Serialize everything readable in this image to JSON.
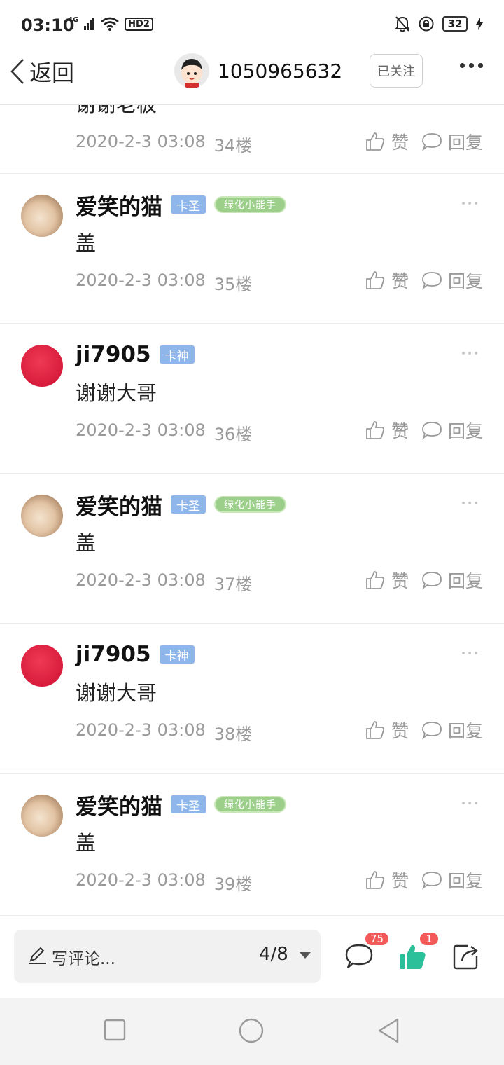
{
  "status": {
    "time": "03:10",
    "network": "4G",
    "hd": "HD2",
    "battery": "32"
  },
  "header": {
    "back_label": "返回",
    "title": "1050965632",
    "follow_label": "已关注"
  },
  "partial_top": {
    "text": "谢谢老板",
    "date": "2020-2-3 03:08",
    "floor": "34楼",
    "like_label": "赞",
    "reply_label": "回复"
  },
  "comments": [
    {
      "name": "爱笑的猫",
      "badge": "卡圣",
      "medal": "绿化小能手",
      "text": "盖",
      "date": "2020-2-3 03:08",
      "floor": "35楼",
      "like_label": "赞",
      "reply_label": "回复"
    },
    {
      "name": "ji7905",
      "badge": "卡神",
      "text": "谢谢大哥",
      "date": "2020-2-3 03:08",
      "floor": "36楼",
      "like_label": "赞",
      "reply_label": "回复"
    },
    {
      "name": "爱笑的猫",
      "badge": "卡圣",
      "medal": "绿化小能手",
      "text": "盖",
      "date": "2020-2-3 03:08",
      "floor": "37楼",
      "like_label": "赞",
      "reply_label": "回复"
    },
    {
      "name": "ji7905",
      "badge": "卡神",
      "text": "谢谢大哥",
      "date": "2020-2-3 03:08",
      "floor": "38楼",
      "like_label": "赞",
      "reply_label": "回复"
    },
    {
      "name": "爱笑的猫",
      "badge": "卡圣",
      "medal": "绿化小能手",
      "text": "盖",
      "date": "2020-2-3 03:08",
      "floor": "39楼",
      "like_label": "赞",
      "reply_label": "回复"
    }
  ],
  "bottom": {
    "write_placeholder": "写评论...",
    "page": "4/8",
    "comment_count": "75",
    "like_count": "1"
  },
  "colors": {
    "badge": "#8fb6ea",
    "like_active": "#2bbf9a",
    "count_badge": "#f25a5a"
  }
}
